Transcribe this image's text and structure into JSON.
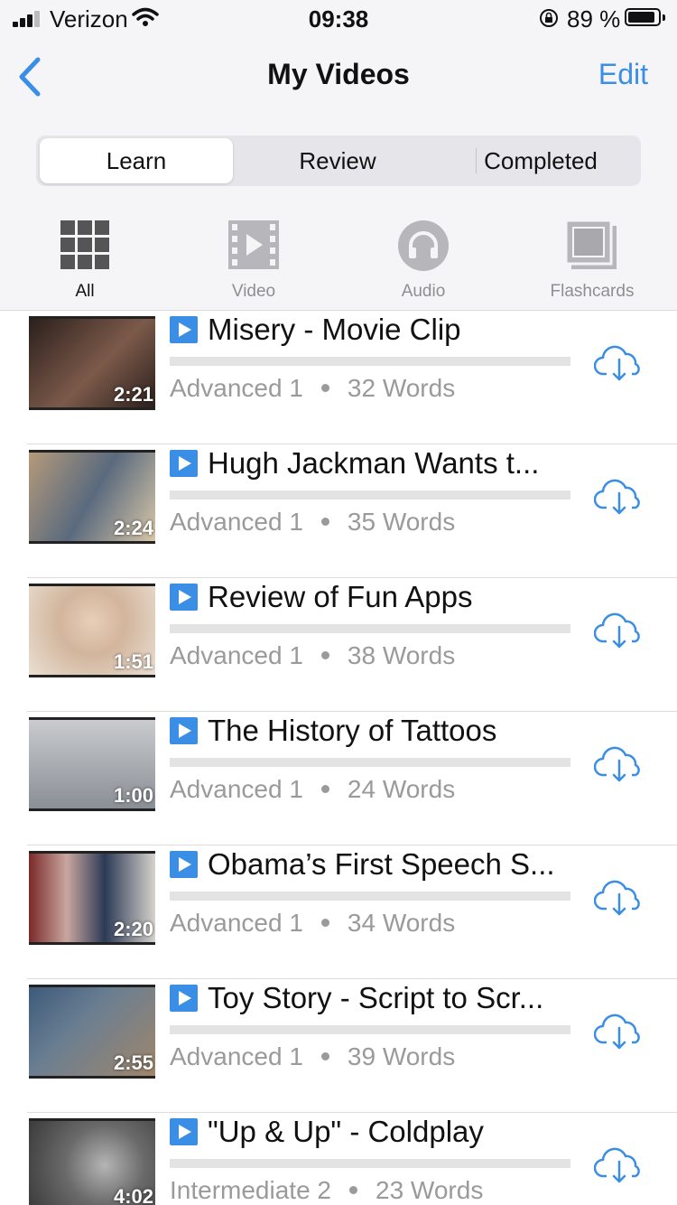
{
  "status_bar": {
    "carrier": "Verizon",
    "time": "09:38",
    "battery_percent": "89 %",
    "battery_level": 0.89
  },
  "nav": {
    "title": "My Videos",
    "edit_label": "Edit"
  },
  "segments": [
    {
      "label": "Learn",
      "selected": true
    },
    {
      "label": "Review",
      "selected": false
    },
    {
      "label": "Completed",
      "selected": false
    }
  ],
  "filters": [
    {
      "label": "All",
      "icon": "grid-icon",
      "selected": true
    },
    {
      "label": "Video",
      "icon": "film-icon",
      "selected": false
    },
    {
      "label": "Audio",
      "icon": "headphones-icon",
      "selected": false
    },
    {
      "label": "Flashcards",
      "icon": "flashcards-icon",
      "selected": false
    }
  ],
  "videos": [
    {
      "title": "Misery - Movie Clip",
      "level": "Advanced 1",
      "words": "32 Words",
      "duration": "2:21",
      "thumb_colors": [
        "#2b1f1c",
        "#7c5a4a"
      ]
    },
    {
      "title": "Hugh Jackman Wants t...",
      "level": "Advanced 1",
      "words": "35 Words",
      "duration": "2:24",
      "thumb_colors": [
        "#5a6a7e",
        "#b49a7a"
      ]
    },
    {
      "title": "Review of Fun Apps",
      "level": "Advanced 1",
      "words": "38 Words",
      "duration": "1:51",
      "thumb_colors": [
        "#d8c2ae",
        "#eadfd3"
      ]
    },
    {
      "title": "The History of Tattoos",
      "level": "Advanced 1",
      "words": "24 Words",
      "duration": "1:00",
      "thumb_colors": [
        "#8a8f96",
        "#c9cbce"
      ]
    },
    {
      "title": "Obama’s First Speech S...",
      "level": "Advanced 1",
      "words": "34 Words",
      "duration": "2:20",
      "thumb_colors": [
        "#7a2a2a",
        "#2c3a56"
      ]
    },
    {
      "title": "Toy Story - Script to Scr...",
      "level": "Advanced 1",
      "words": "39 Words",
      "duration": "2:55",
      "thumb_colors": [
        "#3d5a7a",
        "#a0866a"
      ]
    },
    {
      "title": "\"Up & Up\" - Coldplay",
      "level": "Intermediate 2",
      "words": "23 Words",
      "duration": "4:02",
      "thumb_colors": [
        "#4a4a4a",
        "#9a9a9a"
      ]
    }
  ],
  "accent_color": "#3a8ee6"
}
